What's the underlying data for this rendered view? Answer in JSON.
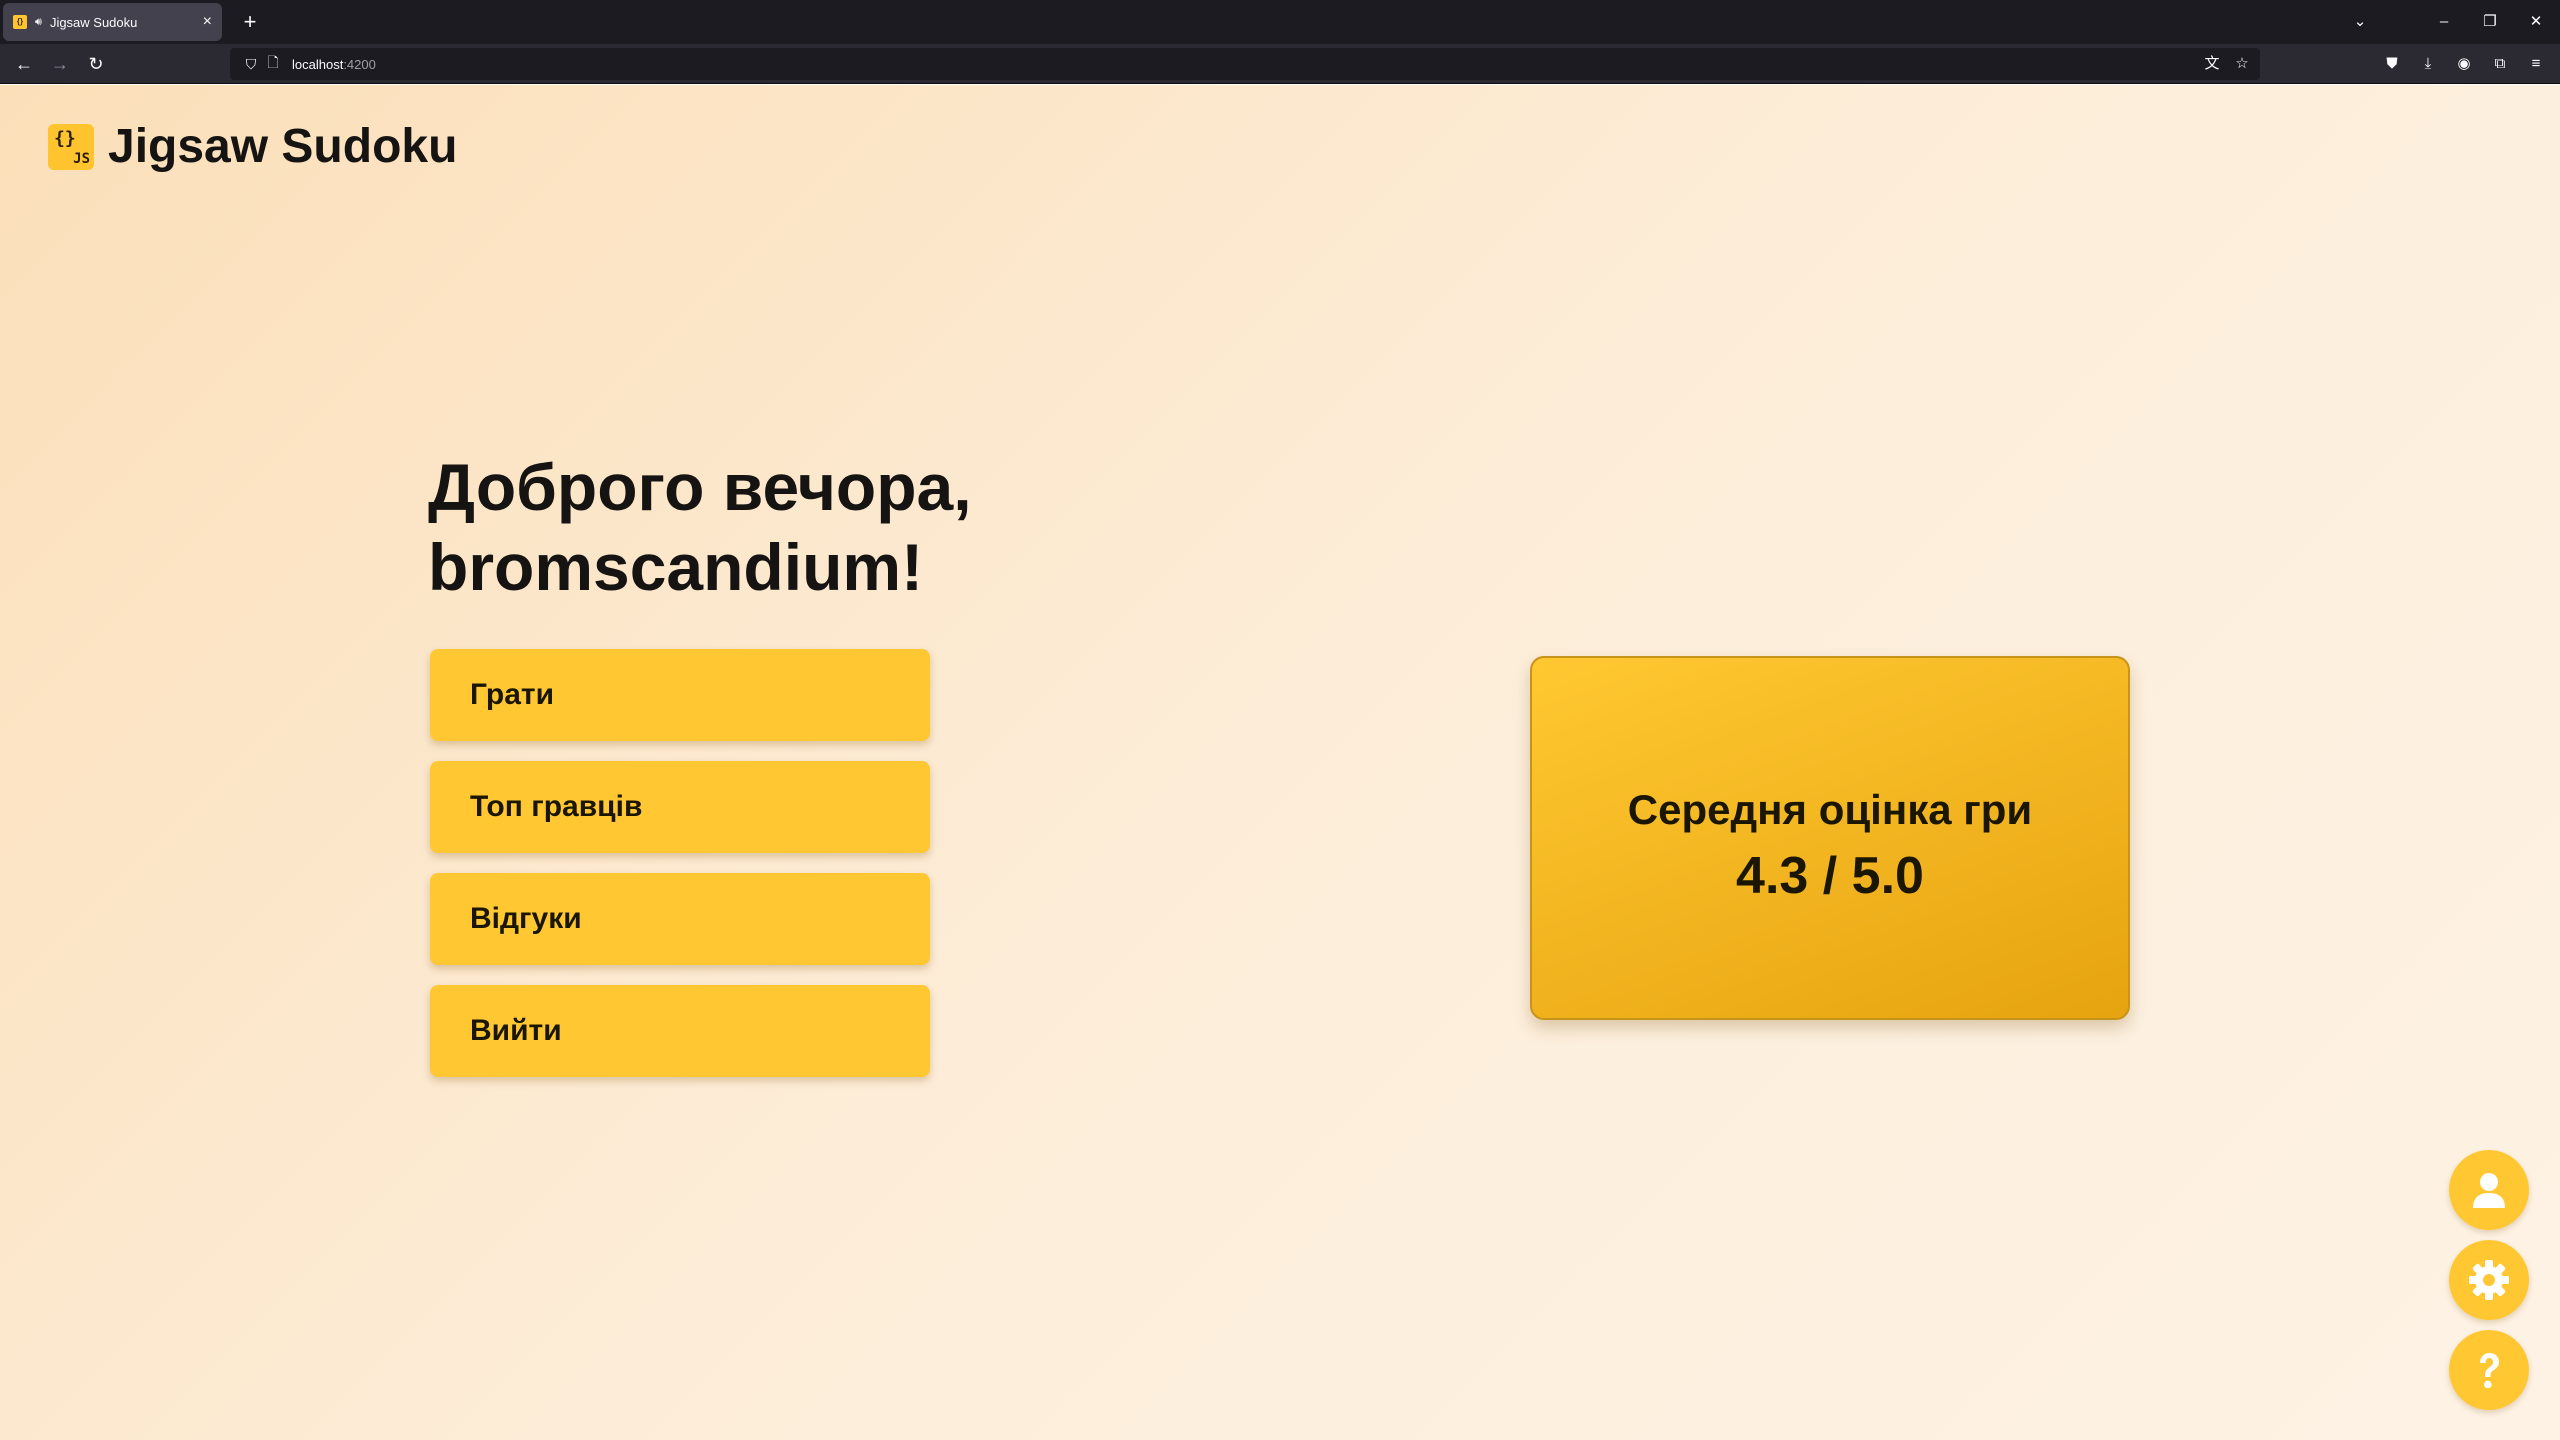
{
  "browser": {
    "tab": {
      "title": "Jigsaw Sudoku",
      "favicon": "{}",
      "close": "×"
    },
    "new_tab": "+",
    "url": {
      "host": "localhost",
      "port": ":4200"
    },
    "window_controls": {
      "list_tabs": "⌄",
      "minimize": "–",
      "restore": "❐",
      "close": "✕"
    }
  },
  "app": {
    "logo": {
      "braces": "{}",
      "js": "JS"
    },
    "title": "Jigsaw Sudoku"
  },
  "greeting": {
    "line1": "Доброго вечора,",
    "line2": "bromscandium!"
  },
  "menu": {
    "play": "Грати",
    "top_players": "Топ гравців",
    "reviews": "Відгуки",
    "logout": "Вийти"
  },
  "rating": {
    "title": "Середня оцінка гри",
    "value": "4.3 / 5.0"
  },
  "fabs": [
    "profile-icon",
    "settings-icon",
    "help-icon"
  ],
  "colors": {
    "accent": "#ffc833",
    "background": "#fbdfb9",
    "text": "#161412"
  }
}
